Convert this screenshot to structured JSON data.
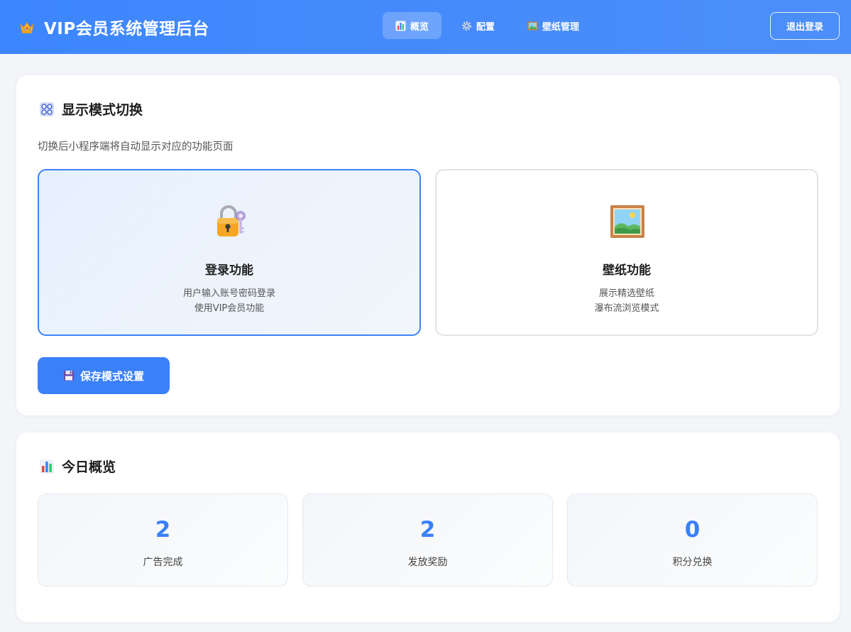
{
  "header": {
    "title": "VIP会员系统管理后台",
    "brand_icon": "crown-icon",
    "nav": [
      {
        "label": "概览",
        "icon": "bar-chart-icon",
        "active": true
      },
      {
        "label": "配置",
        "icon": "gear-icon",
        "active": false
      },
      {
        "label": "壁纸管理",
        "icon": "picture-icon",
        "active": false
      }
    ],
    "logout_label": "退出登录"
  },
  "mode_card": {
    "title": "显示模式切换",
    "icon": "control-panel-icon",
    "description": "切换后小程序端将自动显示对应的功能页面",
    "options": [
      {
        "title": "登录功能",
        "line1": "用户输入账号密码登录",
        "line2": "使用VIP会员功能",
        "icon": "lock-with-key-icon",
        "selected": true
      },
      {
        "title": "壁纸功能",
        "line1": "展示精选壁纸",
        "line2": "瀑布流浏览模式",
        "icon": "framed-picture-icon",
        "selected": false
      }
    ],
    "save_label": "保存模式设置",
    "save_icon": "floppy-disk-icon"
  },
  "stats_card": {
    "title": "今日概览",
    "icon": "bar-chart-icon",
    "items": [
      {
        "value": "2",
        "label": "广告完成"
      },
      {
        "value": "2",
        "label": "发放奖励"
      },
      {
        "value": "0",
        "label": "积分兑换"
      }
    ]
  },
  "colors": {
    "header": "#3c86ff",
    "accent": "#3a80f8",
    "page_bg": "#f3f5f9"
  }
}
